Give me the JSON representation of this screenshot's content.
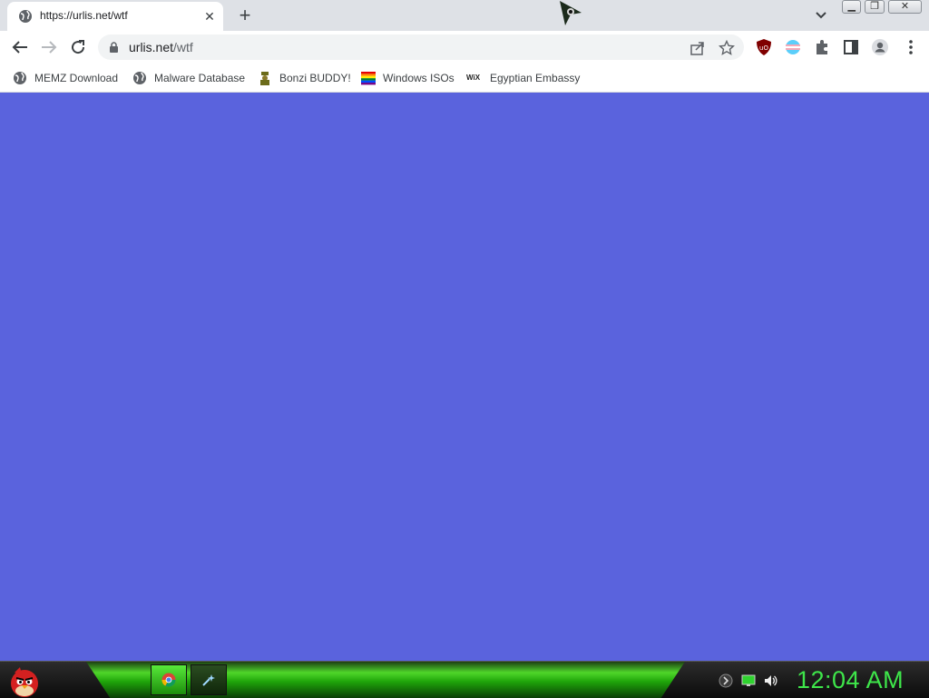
{
  "browser": {
    "tab": {
      "title": "https://urlis.net/wtf",
      "close_label": "✕",
      "icon": "globe-icon"
    },
    "new_tab_label": "+",
    "window_buttons": {
      "minimize": "▁",
      "restore": "❐",
      "close": "✕"
    },
    "address": {
      "host": "urlis.net",
      "path": "/wtf"
    },
    "bookmarks": [
      {
        "label": "MEMZ Download",
        "icon": "globe-icon"
      },
      {
        "label": "Malware Database",
        "icon": "globe-icon"
      },
      {
        "label": "Bonzi BUDDY!",
        "icon": "bonzi-icon"
      },
      {
        "label": "Windows ISOs",
        "icon": "rainbow-flag-icon"
      },
      {
        "label": "Egyptian Embassy",
        "icon": "wix-icon"
      }
    ],
    "wix_text": "WiX"
  },
  "page": {
    "background_color": "#5a63dd"
  },
  "taskbar": {
    "clock": "12:04 AM",
    "accent_color": "#3ee64a"
  }
}
